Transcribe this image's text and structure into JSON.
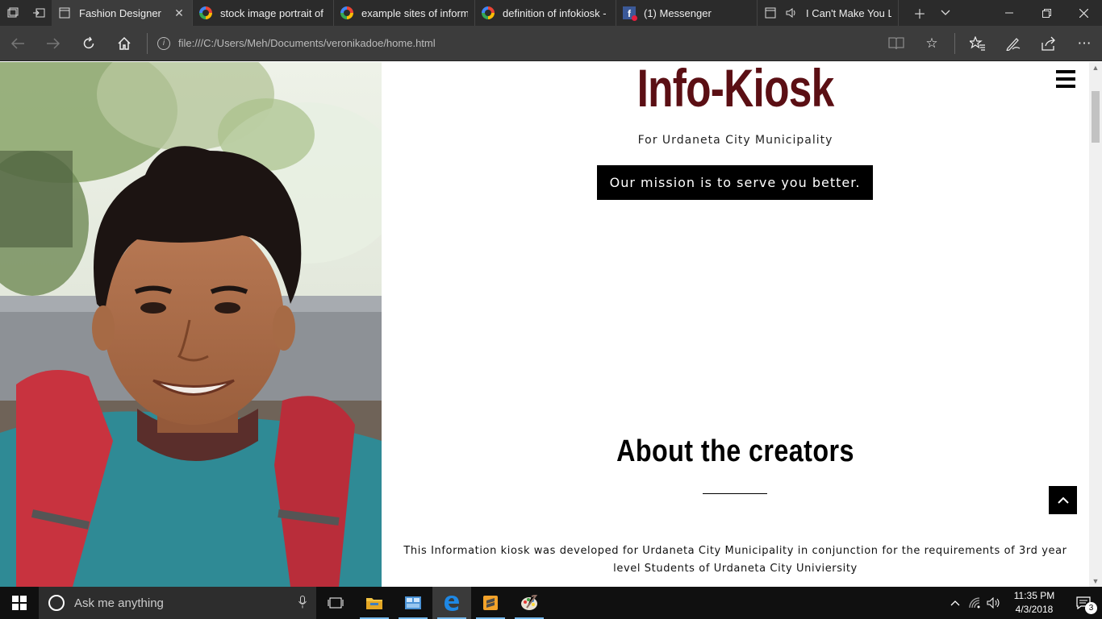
{
  "browser": {
    "tabs": [
      {
        "title": "Fashion Designer",
        "icon": "page-icon",
        "active": true
      },
      {
        "title": "stock image portrait of",
        "icon": "google-icon",
        "active": false
      },
      {
        "title": "example sites of inform",
        "icon": "google-icon",
        "active": false
      },
      {
        "title": "definition of infokiosk -",
        "icon": "google-icon",
        "active": false
      },
      {
        "title": "(1) Messenger",
        "icon": "facebook-icon",
        "active": false
      },
      {
        "title": "I Can't Make You L",
        "icon": "page-icon",
        "active": false
      }
    ],
    "url": "file:///C:/Users/Meh/Documents/veronikadoe/home.html"
  },
  "page": {
    "title": "Info-Kiosk",
    "subtitle": "For Urdaneta City Municipality",
    "mission": "Our mission is to serve you better.",
    "about_title": "About the creators",
    "about_text": "This Information kiosk was developed for Urdaneta City Municipality in conjunction for the requirements of 3rd year level Students of Urdaneta City Univiersity",
    "colors": {
      "title": "#5b0f14",
      "button_bg": "#000000"
    }
  },
  "taskbar": {
    "search_placeholder": "Ask me anything",
    "time": "11:35 PM",
    "date": "4/3/2018",
    "notification_count": "3"
  }
}
